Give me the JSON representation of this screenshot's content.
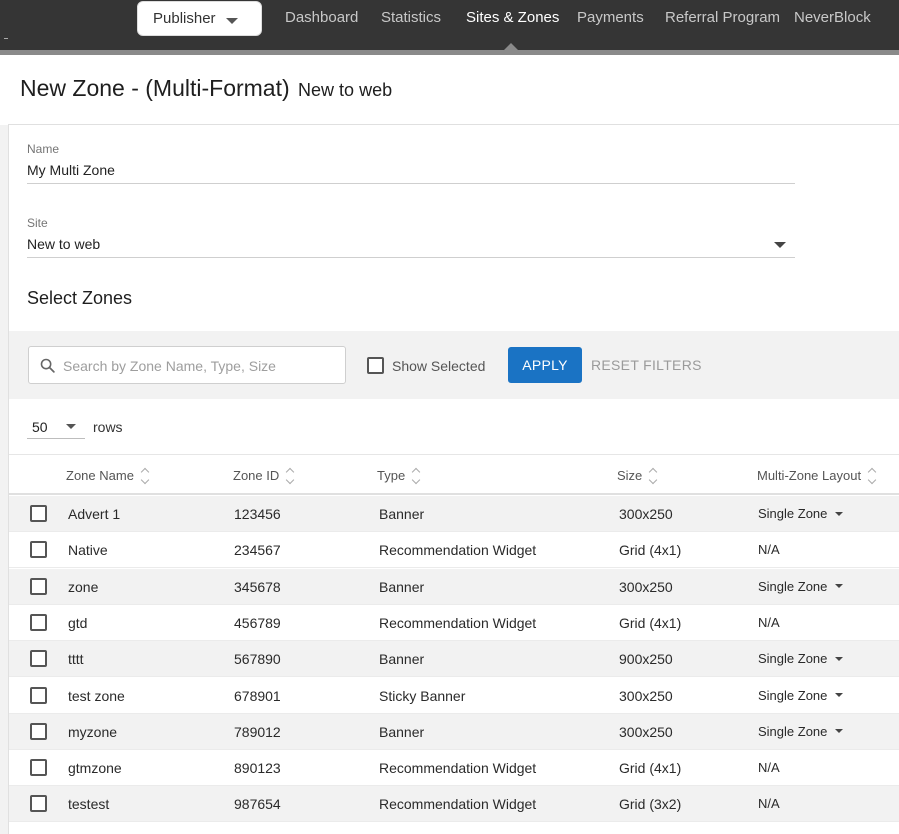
{
  "nav": {
    "publisher_label": "Publisher",
    "links": [
      {
        "label": "Dashboard",
        "active": false
      },
      {
        "label": "Statistics",
        "active": false
      },
      {
        "label": "Sites & Zones",
        "active": true
      },
      {
        "label": "Payments",
        "active": false
      },
      {
        "label": "Referral Program",
        "active": false
      },
      {
        "label": "NeverBlock",
        "active": false
      }
    ]
  },
  "header": {
    "title": "New Zone - (Multi-Format)",
    "subtitle": "New to web"
  },
  "form": {
    "name_label": "Name",
    "name_value": "My Multi Zone",
    "site_label": "Site",
    "site_value": "New to web"
  },
  "select_zones": {
    "title": "Select Zones",
    "search_placeholder": "Search by Zone Name, Type, Size",
    "show_selected_label": "Show Selected",
    "apply_label": "APPLY",
    "reset_label": "RESET  FILTERS",
    "rows_value": "50",
    "rows_label": "rows"
  },
  "table": {
    "columns": [
      "Zone Name",
      "Zone ID",
      "Type",
      "Size",
      "Multi-Zone Layout"
    ],
    "rows": [
      {
        "name": "Advert 1",
        "id": "123456",
        "type": "Banner",
        "size": "300x250",
        "layout": "Single Zone",
        "has_dropdown": true
      },
      {
        "name": "Native",
        "id": "234567",
        "type": "Recommendation Widget",
        "size": "Grid (4x1)",
        "layout": "N/A",
        "has_dropdown": false
      },
      {
        "name": "zone",
        "id": "345678",
        "type": "Banner",
        "size": "300x250",
        "layout": "Single Zone",
        "has_dropdown": true
      },
      {
        "name": "gtd",
        "id": "456789",
        "type": "Recommendation Widget",
        "size": "Grid (4x1)",
        "layout": "N/A",
        "has_dropdown": false
      },
      {
        "name": "tttt",
        "id": "567890",
        "type": "Banner",
        "size": "900x250",
        "layout": "Single Zone",
        "has_dropdown": true
      },
      {
        "name": "test zone",
        "id": "678901",
        "type": "Sticky Banner",
        "size": "300x250",
        "layout": "Single Zone",
        "has_dropdown": true
      },
      {
        "name": "myzone",
        "id": "789012",
        "type": "Banner",
        "size": "300x250",
        "layout": "Single Zone",
        "has_dropdown": true
      },
      {
        "name": "gtmzone",
        "id": "890123",
        "type": "Recommendation Widget",
        "size": "Grid (4x1)",
        "layout": "N/A",
        "has_dropdown": false
      },
      {
        "name": "testest",
        "id": "987654",
        "type": "Recommendation Widget",
        "size": "Grid (3x2)",
        "layout": "N/A",
        "has_dropdown": false
      }
    ]
  },
  "colors": {
    "nav_bg": "#353535",
    "accent": "#1a73c4",
    "row_alt": "#f2f2f2"
  },
  "icons": {
    "search": "search-icon",
    "dropdown": "chevron-down-icon",
    "sort": "sort-icon"
  }
}
